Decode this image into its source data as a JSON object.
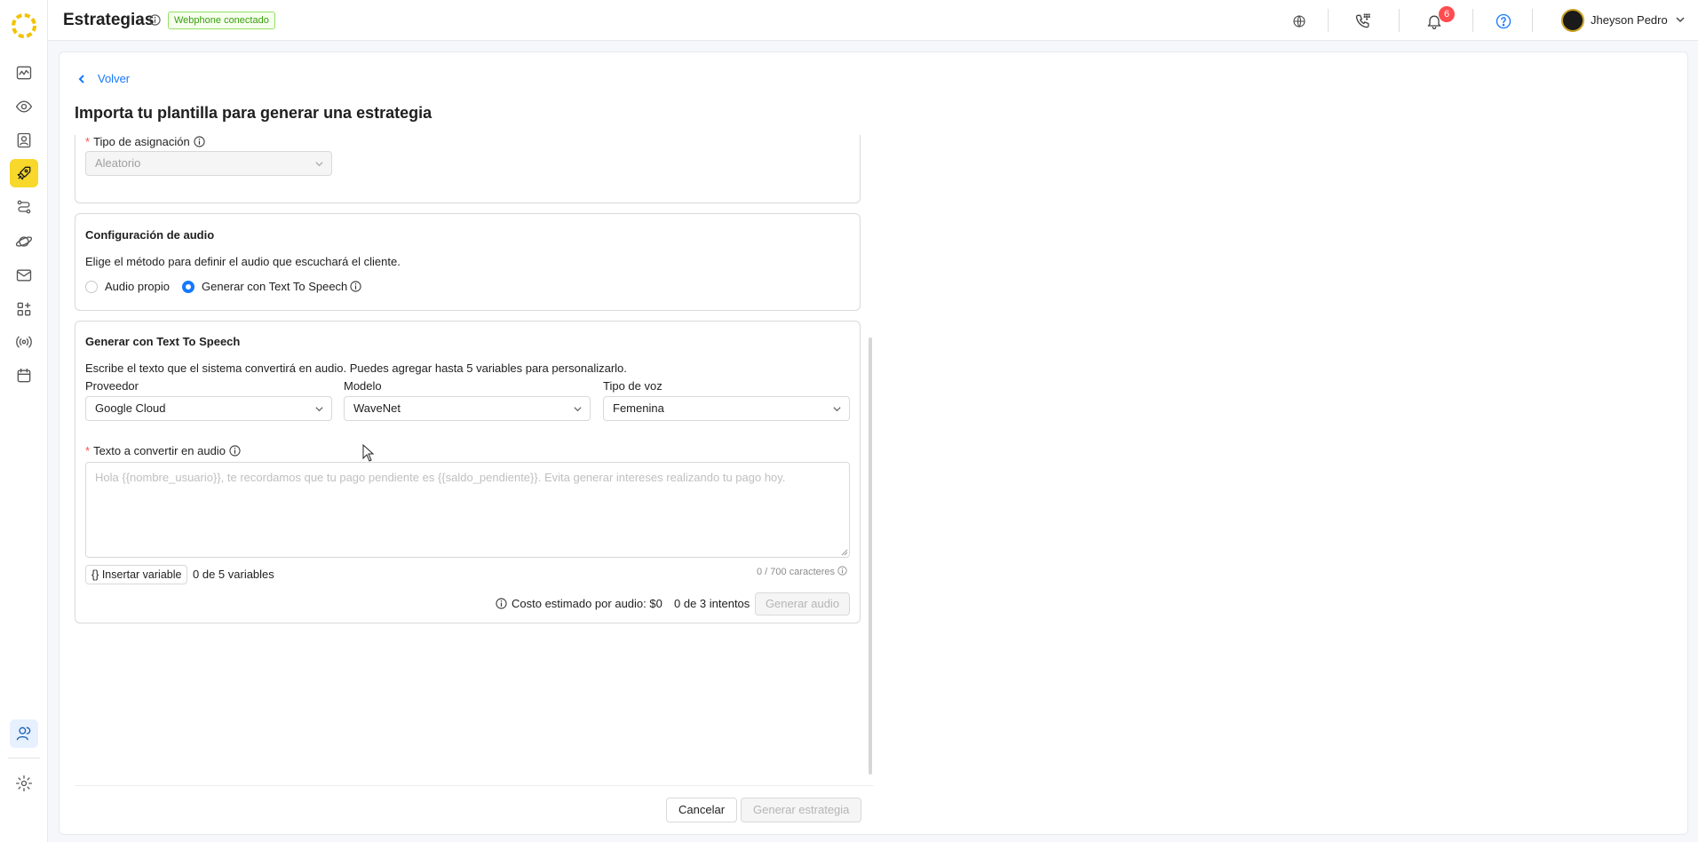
{
  "header": {
    "title": "Estrategias",
    "webphone_badge": "Webphone conectado",
    "notification_count": "6",
    "user_name": "Jheyson Pedro"
  },
  "sidebar": {
    "items": [
      {
        "icon": "activity-icon"
      },
      {
        "icon": "eye-icon"
      },
      {
        "icon": "contact-card-icon"
      },
      {
        "icon": "rocket-icon",
        "active": true
      },
      {
        "icon": "route-icon"
      },
      {
        "icon": "planet-icon"
      },
      {
        "icon": "mail-icon"
      },
      {
        "icon": "apps-icon"
      },
      {
        "icon": "broadcast-icon"
      },
      {
        "icon": "calendar-icon"
      },
      {
        "icon": "users-icon"
      },
      {
        "icon": "gear-icon"
      }
    ]
  },
  "page": {
    "back_label": "Volver",
    "title": "Importa tu plantilla para generar una estrategia"
  },
  "assignment": {
    "label": "Tipo de asignación",
    "value": "Aleatorio"
  },
  "audio_config": {
    "title": "Configuración de audio",
    "description": "Elige el método para definir el audio que escuchará el cliente.",
    "options": [
      {
        "label": "Audio propio",
        "selected": false
      },
      {
        "label": "Generar con Text To Speech",
        "selected": true
      }
    ]
  },
  "tts": {
    "title": "Generar con Text To Speech",
    "description": "Escribe el texto que el sistema convertirá en audio. Puedes agregar hasta 5 variables para personalizarlo.",
    "provider_label": "Proveedor",
    "provider_value": "Google Cloud",
    "model_label": "Modelo",
    "model_value": "WaveNet",
    "voice_label": "Tipo de voz",
    "voice_value": "Femenina",
    "text_label": "Texto a convertir en audio",
    "text_placeholder": "Hola {{nombre_usuario}}, te recordamos que tu pago pendiente es {{saldo_pendiente}}. Evita generar intereses realizando tu pago hoy.",
    "char_count": "0 / 700 caracteres",
    "insert_variable": "{} Insertar variable",
    "variables_count": "0 de 5 variables",
    "cost": "Costo estimado por audio: $0",
    "attempts": "0 de 3 intentos",
    "generate_audio": "Generar audio"
  },
  "footer": {
    "cancel": "Cancelar",
    "generate": "Generar estrategia"
  },
  "colors": {
    "accent": "#1677ff",
    "active_nav": "#f7d82b",
    "badge_green": "#389e0d",
    "notification": "#ff4d4f"
  }
}
